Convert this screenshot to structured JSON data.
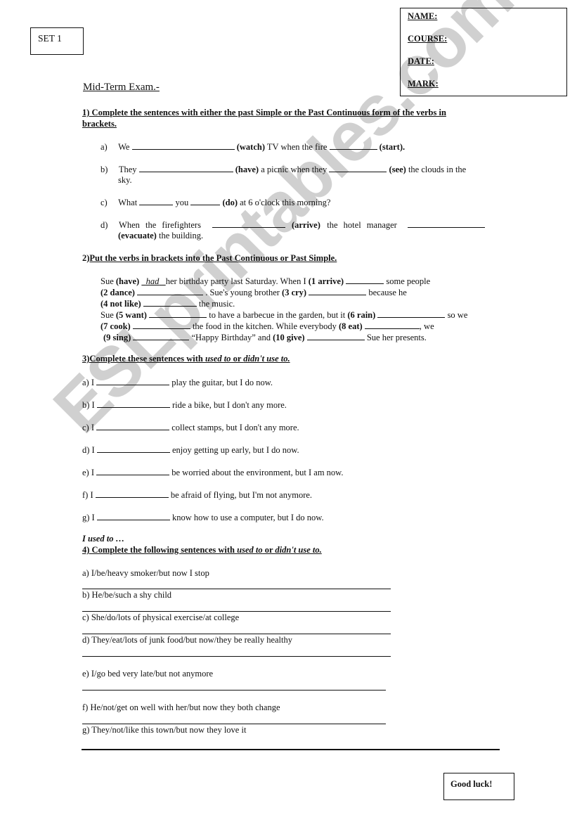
{
  "header": {
    "set_label": "SET 1",
    "fields": [
      "NAME:",
      "COURSE:",
      "DATE:",
      "MARK:"
    ],
    "title": "Mid-Term Exam.-"
  },
  "section1": {
    "instruction": "1) Complete the sentences with either the past Simple or the Past Continuous form of the verbs in",
    "instruction_cont": "brackets.",
    "items": {
      "a": {
        "marker": "a)",
        "t1": "We",
        "v1": "(watch)",
        "t2": "TV when the fire",
        "v2": "(start)."
      },
      "b": {
        "marker": "b)",
        "t1": "They",
        "v1": "(have)",
        "t2": "a picnic when they",
        "v2": "(see)",
        "t3": "the clouds in the",
        "t4": "sky."
      },
      "c": {
        "marker": "c)",
        "t1": "What",
        "t2": "you",
        "v1": "(do)",
        "t3": "at 6 o'clock this morning?"
      },
      "d": {
        "marker": "d)",
        "t1": "When the firefighters",
        "v1": "(arrive)",
        "t2": "the hotel manager",
        "v2": "(evacuate)",
        "t3": "the building."
      }
    }
  },
  "section2": {
    "number": "2)",
    "instruction": "Put the verbs in brackets into the Past Continuous or Past Simple.",
    "lines": {
      "l1": {
        "t1": "Sue",
        "v1": "(have)",
        "example": "had",
        "t2": "her birthday party last Saturday. When I",
        "v2": "(1 arrive)",
        "t3": "some people"
      },
      "l2": {
        "v1": "(2 dance)",
        "t1": ". Sue's young brother",
        "v2": "(3 cry)",
        "t2": "because he"
      },
      "l3": {
        "v1": "(4 not like)",
        "t1": "the music."
      },
      "l4": {
        "t1": "Sue",
        "v1": "(5 want)",
        "t2": "to have a barbecue in the garden, but it",
        "v2": "(6 rain)",
        "t3": "so we"
      },
      "l5": {
        "v1": "(7 cook)",
        "t1": "the food in the kitchen. While everybody",
        "v2": "(8 eat)",
        "t2": ", we"
      },
      "l6": {
        "v1": "(9 sing)",
        "t1": "“Happy Birthday” and",
        "v2": "(10 give)",
        "t2": "Sue her presents."
      }
    }
  },
  "section3": {
    "instruction_pre": "3)Complete these sentences with ",
    "instruction_i1": "used to",
    "instruction_mid": " or ",
    "instruction_i2": "didn't use to.",
    "items": [
      {
        "marker": "a) I",
        "text": "play the guitar, but I do now."
      },
      {
        "marker": "b) I",
        "text": "ride a bike, but I don't any more."
      },
      {
        "marker": "c) I",
        "text": "collect stamps, but I don't any more."
      },
      {
        "marker": "d) I",
        "text": "enjoy getting up early, but I do now."
      },
      {
        "marker": "e) I",
        "text": "be worried about the environment, but I am now."
      },
      {
        "marker": "f) I",
        "text": "be afraid of flying, but I'm not anymore."
      },
      {
        "marker": "g) I",
        "text": "know how to use a computer, but I do now."
      }
    ]
  },
  "section4": {
    "pre_title": "I used to …",
    "instruction_pre": "4) Complete the following sentences with ",
    "instruction_i1": "used to",
    "instruction_mid": " or ",
    "instruction_i2": "didn't use to.",
    "items": [
      "a) I/be/heavy smoker/but now I stop",
      "b) He/be/such a shy child",
      "c) She/do/lots of physical exercise/at college",
      "d) They/eat/lots of junk food/but now/they be really healthy",
      "e) I/go bed very late/but not anymore",
      "f) He/not/get on well with her/but now they both change",
      "g) They/not/like this town/but now they love it"
    ]
  },
  "footer": {
    "good_luck": "Good luck!"
  },
  "watermark": {
    "text": "ESLprintables.com",
    "color": "#c8c8c8"
  }
}
